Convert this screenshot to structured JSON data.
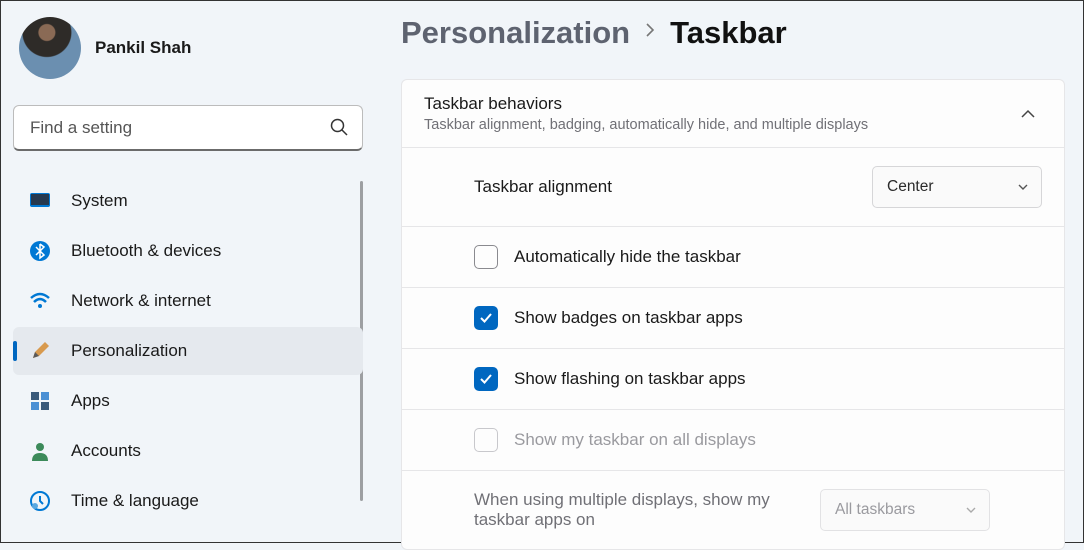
{
  "user": {
    "name": "Pankil Shah"
  },
  "search": {
    "placeholder": "Find a setting"
  },
  "nav": [
    {
      "key": "system",
      "label": "System"
    },
    {
      "key": "bluetooth",
      "label": "Bluetooth & devices"
    },
    {
      "key": "network",
      "label": "Network & internet"
    },
    {
      "key": "personalization",
      "label": "Personalization",
      "active": true
    },
    {
      "key": "apps",
      "label": "Apps"
    },
    {
      "key": "accounts",
      "label": "Accounts"
    },
    {
      "key": "time",
      "label": "Time & language"
    }
  ],
  "breadcrumb": {
    "parent": "Personalization",
    "current": "Taskbar"
  },
  "card": {
    "title": "Taskbar behaviors",
    "subtitle": "Taskbar alignment, badging, automatically hide, and multiple displays"
  },
  "rows": {
    "alignment": {
      "label": "Taskbar alignment",
      "value": "Center"
    },
    "autohide": {
      "label": "Automatically hide the taskbar",
      "checked": false
    },
    "badges": {
      "label": "Show badges on taskbar apps",
      "checked": true
    },
    "flashing": {
      "label": "Show flashing on taskbar apps",
      "checked": true
    },
    "allDisplays": {
      "label": "Show my taskbar on all displays",
      "checked": false,
      "disabled": true
    },
    "multiDisplay": {
      "label": "When using multiple displays, show my taskbar apps on",
      "value": "All taskbars",
      "disabled": true
    }
  }
}
